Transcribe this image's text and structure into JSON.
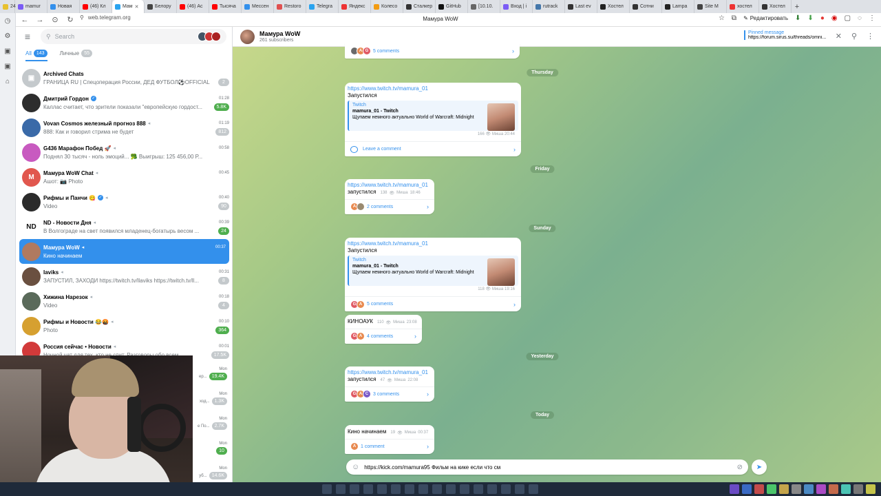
{
  "browser": {
    "tabs": [
      {
        "label": "24",
        "color": "#e8c12e"
      },
      {
        "label": "mamur",
        "color": "#7b5cf5"
      },
      {
        "label": "Новая",
        "color": "#3390ec"
      },
      {
        "label": "(46) Кл",
        "color": "#ff0000"
      },
      {
        "label": "Мам",
        "color": "#2aa3ef",
        "active": true
      },
      {
        "label": "Белору",
        "color": "#444"
      },
      {
        "label": "(46) Ас",
        "color": "#ff0000"
      },
      {
        "label": "Тысяча",
        "color": "#ff0000"
      },
      {
        "label": "Мессен",
        "color": "#3390ec"
      },
      {
        "label": "Restoro",
        "color": "#e05050"
      },
      {
        "label": "Telegra",
        "color": "#2aa3ef"
      },
      {
        "label": "Яндекс",
        "color": "#e33"
      },
      {
        "label": "Колесо",
        "color": "#f39c12"
      },
      {
        "label": "Сталкер",
        "color": "#333"
      },
      {
        "label": "GitHub",
        "color": "#111"
      },
      {
        "label": "[10.10.",
        "color": "#666"
      },
      {
        "label": "Вход | i",
        "color": "#7b5cf5"
      },
      {
        "label": "rutrack",
        "color": "#4477aa"
      },
      {
        "label": "Last ev",
        "color": "#333"
      },
      {
        "label": "Хостел",
        "color": "#222"
      },
      {
        "label": "Сотни",
        "color": "#333"
      },
      {
        "label": "Lampa",
        "color": "#222"
      },
      {
        "label": "Site M",
        "color": "#444"
      },
      {
        "label": "хостел",
        "color": "#e33"
      },
      {
        "label": "Хостел",
        "color": "#333"
      }
    ],
    "new_tab": "+",
    "url": "web.telegram.org",
    "page_title": "Мамура WoW",
    "edit_label": "Редактировать"
  },
  "sidebar": {
    "search_placeholder": "Search",
    "folders": [
      {
        "label": "All",
        "count": "143",
        "active": true
      },
      {
        "label": "Личные",
        "count": "55",
        "active": false
      }
    ],
    "chats": [
      {
        "name": "Archived Chats",
        "preview": "ГРАНИЦА RU | Спецоперация России, ДЕД ФУТБОЛ⚽OFFICIAL",
        "time": "",
        "count": "2",
        "badge": "grey",
        "avatar": "#c4c9cc",
        "initial": "▣"
      },
      {
        "name": "Дмитрий Гордон",
        "verified": true,
        "preview": "Каллас считает, что зрители показали \"европейскую гордост...",
        "time": "01:28",
        "count": "5.8K",
        "badge": "green",
        "avatar": "#2d2d2d",
        "initial": ""
      },
      {
        "name": "Vovan Cosmos железный прогноз 888",
        "preview": "888: Как и говорил стрима не будет",
        "preview_highlight": "",
        "time": "01:19",
        "count": "812",
        "badge": "grey",
        "avatar": "#3a6aa8",
        "initial": ""
      },
      {
        "name": "G436 Марафон Побед 🚀",
        "preview": "Поднял 30 тысяч - ноль эмоций... 🥦 Выигрыш: 125 456,00 Р...",
        "time": "00:58",
        "count": "",
        "badge": "",
        "avatar": "#c85ac0",
        "initial": ""
      },
      {
        "name": "Мамура WoW Chat",
        "preview": "Ашот: 📷 Photo",
        "time": "00:45",
        "count": "",
        "badge": "",
        "avatar": "#e1574e",
        "initial": "M"
      },
      {
        "name": "Рифмы и Панчи 😋",
        "verified": true,
        "preview": "Video",
        "time": "00:40",
        "count": "90",
        "badge": "grey",
        "avatar": "#2b2b2b",
        "initial": ""
      },
      {
        "name": "ND - Новости Дня",
        "preview": "В Волгограде на свет появился младенец-богатырь весом ...",
        "time": "00:39",
        "count": "24",
        "badge": "green",
        "avatar": "#ffffff",
        "initial": "ND"
      },
      {
        "name": "Мамура WoW",
        "preview": "Кино начинаем",
        "time": "00:37",
        "count": "",
        "badge": "",
        "avatar": "#b07a60",
        "initial": "",
        "active": true
      },
      {
        "name": "Iaviks",
        "preview": "ЗАПУСТИЛ, ЗАХОДИ https://twitch.tv/llaviks https://twitch.tv/ll...",
        "time": "00:31",
        "count": "8",
        "badge": "grey",
        "avatar": "#6a5040",
        "initial": ""
      },
      {
        "name": "Хижина Нарезок",
        "preview": "Video",
        "time": "00:18",
        "count": "4",
        "badge": "grey",
        "avatar": "#5a6a5a",
        "initial": ""
      },
      {
        "name": "Рифмы и Новости 😂🤬",
        "preview": "Photo",
        "time": "00:10",
        "count": "364",
        "badge": "green",
        "avatar": "#d6a030",
        "initial": ""
      },
      {
        "name": "Россия сейчас • Новости",
        "preview": "Ночной чат для тех, кто не спит. Разговоры обо всем...",
        "time": "00:01",
        "count": "17.5K",
        "badge": "grey",
        "avatar": "#d23a3a",
        "initial": ""
      }
    ],
    "hidden_rows": [
      {
        "time": "Mon",
        "snippet": "ер...",
        "count": "19.4K",
        "badge": "green"
      },
      {
        "time": "Mon",
        "snippet": "ход...",
        "count": "1.3K",
        "badge": "grey"
      },
      {
        "time": "Mon",
        "snippet": "е По...",
        "count": "2.7K",
        "badge": "grey"
      },
      {
        "time": "Mon",
        "snippet": "",
        "count": "10",
        "badge": "green"
      },
      {
        "time": "Mon",
        "snippet": "уб...",
        "count": "14.6K",
        "badge": "grey"
      }
    ]
  },
  "chat": {
    "title": "Мамура WoW",
    "subscribers": "261 subscribers",
    "pinned_label": "Pinned message",
    "pinned_value": "https://forum.sirus.su/threads/omni...",
    "dates": [
      "Thursday",
      "Friday",
      "Sunday",
      "Yesterday",
      "Today"
    ],
    "messages": [
      {
        "comments": "5 comments"
      },
      {
        "link": "https://www.twitch.tv/mamura_01",
        "text": "Запустился",
        "site": "Twitch",
        "ptitle": "mamura_01 - Twitch",
        "pdesc": "Щупаем немного актуально World of Warcraft: Midnight",
        "views": "166",
        "author": "Миша",
        "time": "20:44",
        "comments": "Leave a comment"
      },
      {
        "link": "https://www.twitch.tv/mamura_01",
        "text": "запустился",
        "views": "138",
        "author": "Миша",
        "time": "18:46",
        "comments": "2 comments"
      },
      {
        "link": "https://www.twitch.tv/mamura_01",
        "text": "Запустился",
        "site": "Twitch",
        "ptitle": "mamura_01 - Twitch",
        "pdesc": "Щупаем немного актуально World of Warcraft: Midnight",
        "views": "118",
        "author": "Миша",
        "time": "19:16",
        "comments": "5 comments"
      },
      {
        "text": "КИНОАУК",
        "views": "110",
        "author": "Миша",
        "time": "23:08",
        "comments": "4 comments"
      },
      {
        "link": "https://www.twitch.tv/mamura_01",
        "text": "запустился",
        "views": "47",
        "author": "Миша",
        "time": "22:08",
        "comments": "3 comments"
      },
      {
        "text": "Кино начинаем",
        "views": "19",
        "author": "Миша",
        "time": "00:37",
        "comments": "1 comment"
      }
    ],
    "composer_value": "https://kick.com/mamura95 Фильм на кике если что см"
  },
  "colors": {
    "accent": "#3390ec",
    "unread_green": "#4fae4e",
    "unread_grey": "#c4c9cc"
  }
}
